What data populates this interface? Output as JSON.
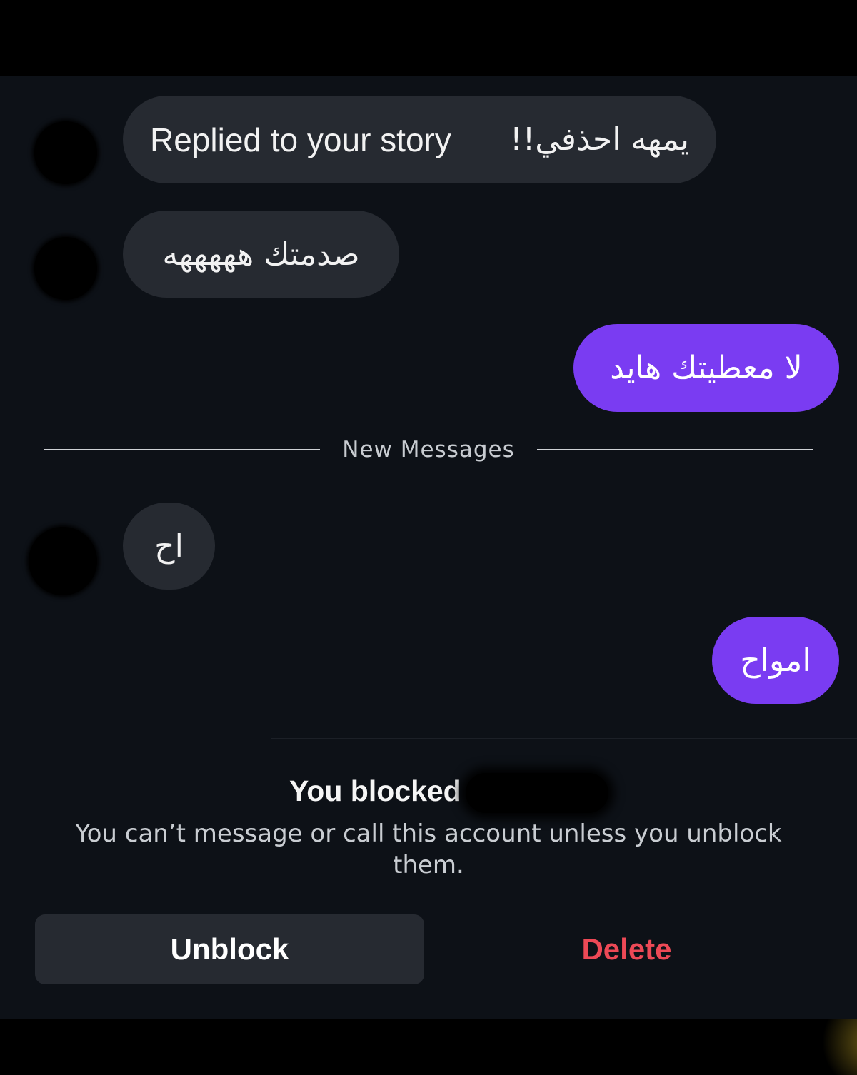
{
  "messages": [
    {
      "direction": "incoming",
      "label": "Replied to your story",
      "text": "يمهه احذفي!!"
    },
    {
      "direction": "incoming",
      "text": "صدمتك هههههه"
    },
    {
      "direction": "outgoing",
      "text": "لا معطيتك هايد"
    },
    {
      "direction": "incoming",
      "text": "اح"
    },
    {
      "direction": "outgoing",
      "text": "امواح"
    }
  ],
  "divider": {
    "text": "New Messages"
  },
  "blocked": {
    "title": "You blocked",
    "description": "You can’t message or call this account unless you unblock them."
  },
  "actions": {
    "unblock": "Unblock",
    "delete": "Delete"
  },
  "colors": {
    "outgoing_bubble": "#7a3cf2",
    "incoming_bubble": "#262a31",
    "delete": "#ed4956"
  }
}
